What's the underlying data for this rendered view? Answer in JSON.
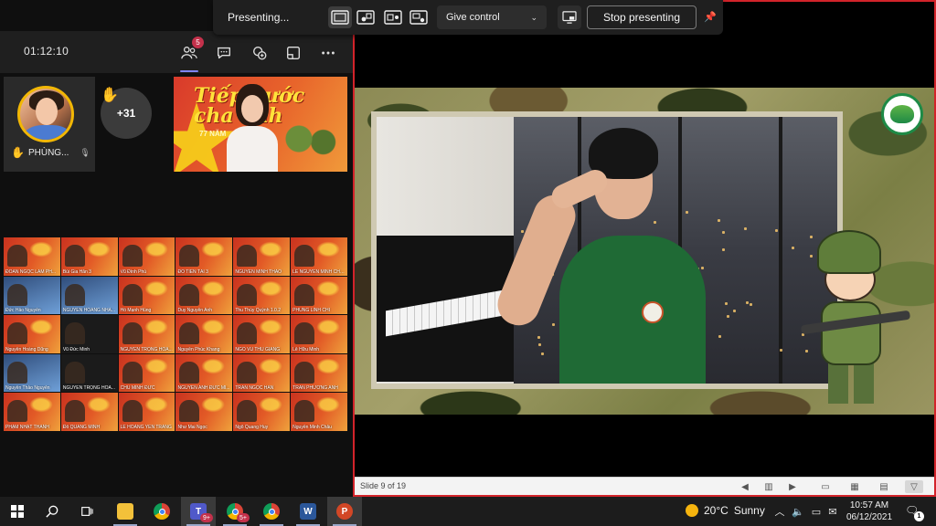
{
  "presenter_toolbar": {
    "status": "Presenting...",
    "give_control": "Give control",
    "stop_presenting": "Stop presenting"
  },
  "meeting": {
    "timer": "01:12:10",
    "people_count": "5",
    "participants": {
      "featured_name": "PHÙNG...",
      "overflow_count": "+31"
    },
    "presenter_slide": {
      "title": "Tiếp bước cha anh",
      "subtitle": "77 NĂM"
    },
    "gallery": [
      "ĐOÀN NGỌC LÂM PH...",
      "Bùi Gia Hân 3",
      "Vũ Đình Phú",
      "ĐỖ TIẾN TÀI 3",
      "NGUYỄN MINH THẢO",
      "LÊ NGUYỄN MINH CHÂU",
      "Đức Hảo Nguyễn",
      "NGUYỄN HOÀNG NHẬ...",
      "Hồ Mạnh Hùng",
      "Duy Nguyễn Anh",
      "Thu Thủy Quỳnh 1.0.2",
      "PHÙNG LINH CHI",
      "Nguyễn Hoàng Dũng",
      "Vũ Đức Minh",
      "NGUYỄN TRỌNG HOÀ...",
      "Nguyễn Phúc Khang",
      "NGÔ VŨ THU GIANG",
      "Lê Hữu Minh",
      "Nguyễn Thảo Nguyên",
      "NGUYỄN TRỌNG HOÀ...",
      "CHU MINH ĐỨC",
      "NGUYỄN ANH ĐỨC MI...",
      "TRẦN NGỌC HÀN",
      "TRẦN PHƯƠNG ANH",
      "PHẠM NHẬT THÀNH",
      "Đỗ QUANG MINH",
      "LÊ HOÀNG YẾN TRANG",
      "Như Mai Ngọc",
      "Ngô Quang Huy",
      "Nguyễn Minh Châu"
    ]
  },
  "powerpoint": {
    "slide_counter": "Slide 9 of 19"
  },
  "taskbar": {
    "teams_badge": "9+",
    "chrome_badge": "5+",
    "weather_temp": "20°C",
    "weather_desc": "Sunny",
    "time": "10:57 AM",
    "date": "06/12/2021",
    "notification_count": "1",
    "word_letter": "W",
    "ppt_letter": "P"
  },
  "colors": {
    "ppt_border": "#d2232a",
    "teams_accent": "#7f85f5",
    "badge_red": "#c4314b"
  },
  "icons": [
    "windows-icon",
    "search-icon",
    "task-view-icon",
    "file-explorer-icon",
    "chrome-icon",
    "teams-icon",
    "word-icon",
    "powerpoint-icon"
  ]
}
